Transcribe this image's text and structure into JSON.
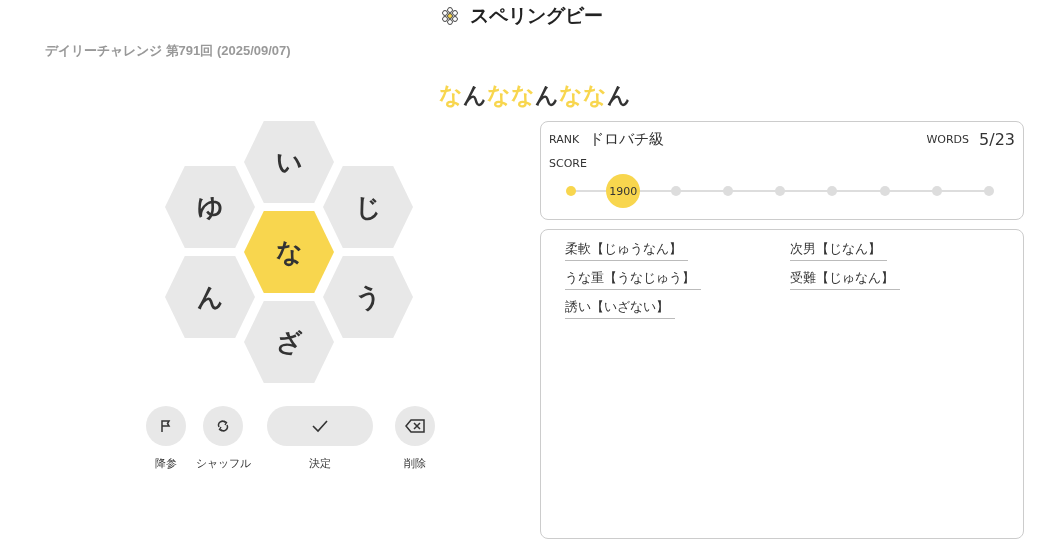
{
  "header": {
    "title": "スペリングビー"
  },
  "subtitle": "デイリーチャレンジ 第791回 (2025/09/07)",
  "current_word": [
    {
      "char": "な",
      "center": true
    },
    {
      "char": "ん",
      "center": false
    },
    {
      "char": "な",
      "center": true
    },
    {
      "char": "な",
      "center": true
    },
    {
      "char": "ん",
      "center": false
    },
    {
      "char": "な",
      "center": true
    },
    {
      "char": "な",
      "center": true
    },
    {
      "char": "ん",
      "center": false
    }
  ],
  "hive": [
    {
      "letter": "い",
      "center": false
    },
    {
      "letter": "ゆ",
      "center": false
    },
    {
      "letter": "じ",
      "center": false
    },
    {
      "letter": "な",
      "center": true
    },
    {
      "letter": "ん",
      "center": false
    },
    {
      "letter": "う",
      "center": false
    },
    {
      "letter": "ざ",
      "center": false
    }
  ],
  "actions": [
    {
      "kind": "flag",
      "label": "降参"
    },
    {
      "kind": "shuffle",
      "label": "シャッフル"
    },
    {
      "kind": "enter",
      "label": "決定"
    },
    {
      "kind": "delete",
      "label": "削除"
    }
  ],
  "status": {
    "rank_label": "RANK",
    "rank": "ドロバチ級",
    "words_label": "WORDS",
    "words": "5/23",
    "score_label": "SCORE",
    "steps": [
      {
        "reached": true,
        "current": false
      },
      {
        "reached": true,
        "current": true,
        "label": "1900"
      },
      {
        "reached": false,
        "current": false
      },
      {
        "reached": false,
        "current": false
      },
      {
        "reached": false,
        "current": false
      },
      {
        "reached": false,
        "current": false
      },
      {
        "reached": false,
        "current": false
      },
      {
        "reached": false,
        "current": false
      },
      {
        "reached": false,
        "current": false
      }
    ]
  },
  "found_words": [
    "柔軟【じゅうなん】",
    "次男【じなん】",
    "うな重【うなじゅう】",
    "受難【じゅなん】",
    "誘い【いざない】"
  ]
}
